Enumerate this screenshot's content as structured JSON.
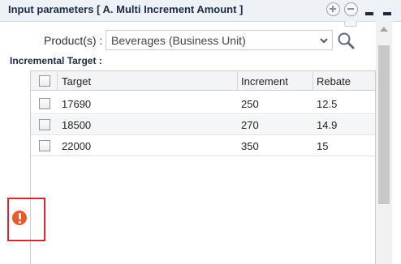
{
  "header": {
    "title": "Input parameters [ A. Multi Increment Amount ]",
    "icons": [
      "plus-circle-icon",
      "minus-circle-icon",
      "minimize-icon",
      "close-icon"
    ]
  },
  "product": {
    "label": "Product(s) :",
    "selected": "Beverages (Business Unit)"
  },
  "incremental": {
    "label": "Incremental Target :"
  },
  "grid": {
    "columns": [
      "Target",
      "Increment",
      "Rebate"
    ],
    "rows": [
      {
        "target": "17690",
        "increment": "250",
        "rebate": "12.5"
      },
      {
        "target": "18500",
        "increment": "270",
        "rebate": "14.9"
      },
      {
        "target": "22000",
        "increment": "350",
        "rebate": "15"
      }
    ]
  },
  "alert": {
    "icon": "exclamation-circle-icon",
    "color": "#e85a2a",
    "highlight_color": "#d9252b"
  }
}
